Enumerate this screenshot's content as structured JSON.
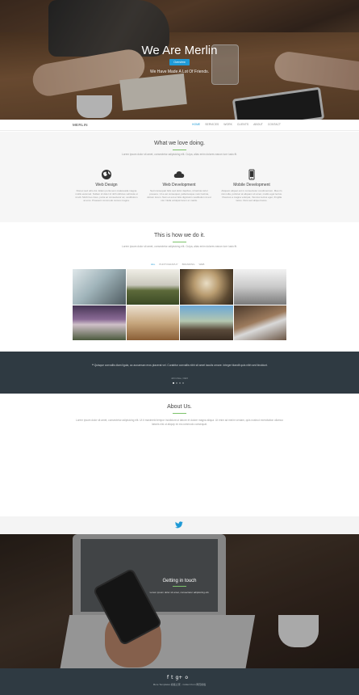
{
  "hero": {
    "title": "We Are Merlin",
    "badge": "Overview",
    "subtitle": "We Have Made A Lot Of Friends."
  },
  "nav": {
    "brand": "MERLIN",
    "items": [
      "HOME",
      "SERVICES",
      "WORK",
      "CLIENTS",
      "ABOUT",
      "CONTACT"
    ]
  },
  "services": {
    "title": "What we love doing.",
    "subtitle": "Lorem ipsum dolor sit amet, consectetur adipisicing elit. Culpa, alias enim dolores earum iure iusto fit.",
    "items": [
      {
        "icon": "globe-icon",
        "title": "Web Design",
        "text": "Donec sed odio dui. Etiam porta sem malesuada magna mollis euismod. Nullam id dolor id nibh ultricies vehicula ut id elit. Morbi leo risus, porta ac consectetur ac, vestibulum at eros. Praesent commodo cursus magna."
      },
      {
        "icon": "cloud-icon",
        "title": "Web Development",
        "text": "Sed consequat felis sed dolor dapibus, id lacinia tortor posuere. Ut a est consequat, pellentesque nunc lacinia, dictum lorem. Nam et est et felis dignissim vestibulum id est nisi. Nulla volutpat lorem et mattis."
      },
      {
        "icon": "mobile-icon",
        "title": "Mobile Development",
        "text": "Aliquam aliquet est in consectetur condimentum. Mau ris nisi nulla, pulvinar at aliquam sit amet, mattis eget lectus. Vivamus a magna volutpat, rhoncus lectus eget, fringilla lacus. Duis sed aliquet lacus."
      }
    ]
  },
  "portfolio": {
    "title": "This is how we do it.",
    "subtitle": "Lorem ipsum dolor sit amet, consectetur adipisicing elit. Culpa, alias enim dolores earum iure iusto fit.",
    "filters": [
      "ALL",
      "PHOTOGRAPHY",
      "BRANDING",
      "WEB"
    ]
  },
  "testimonial": {
    "quote": "Quisque convallis diam ligula, ac accumsan eros placerat vel. Curabitur convallis nibh sit amet iaculis ornare. Integer blandit quis nibh sed tincidunt.",
    "author": "John Doe, CEO"
  },
  "about": {
    "title": "About Us.",
    "text": "Lorem ipsum dolor sit amet, consectetur adipisicing elit. Ut it maximeld tempor incididunt ut labore et dolore magna aliqua. Ut enim ad minim veniam, quis nostrud exercitation ullamco laboris nisi ut aliquip ex ea commodo consequat."
  },
  "contact": {
    "title": "Getting in touch",
    "subtitle": "Lorem ipsum dolor sit amet, consectetur adipisicing elit."
  },
  "footer": {
    "social": [
      "f",
      "t",
      "g+",
      "o"
    ],
    "copyright": "More Templates 模板之家 - Collect from 网页模板"
  },
  "colors": {
    "accent": "#1f9ad6",
    "divider": "#7cc36a",
    "dark": "#2f3a42"
  }
}
